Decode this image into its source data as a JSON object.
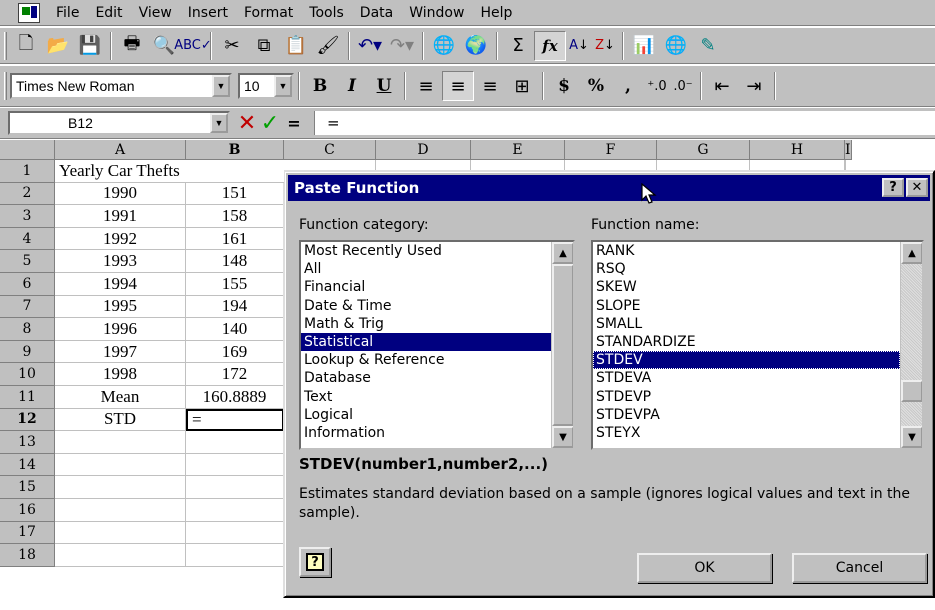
{
  "menubar": {
    "items": [
      {
        "label": "File"
      },
      {
        "label": "Edit"
      },
      {
        "label": "View"
      },
      {
        "label": "Insert"
      },
      {
        "label": "Format"
      },
      {
        "label": "Tools"
      },
      {
        "label": "Data"
      },
      {
        "label": "Window"
      },
      {
        "label": "Help"
      }
    ]
  },
  "formatting": {
    "font_name": "Times New Roman",
    "font_size": "10",
    "bold": "B",
    "italic": "I",
    "underline": "U",
    "currency": "$",
    "percent": "%",
    "comma": ","
  },
  "standard_toolbar": {
    "autosum": "Σ",
    "paste_function": "fx"
  },
  "formula_bar": {
    "name_box": "B12",
    "content": "="
  },
  "sheet": {
    "columns": [
      "A",
      "B",
      "C",
      "D",
      "E",
      "F",
      "G",
      "H",
      "I"
    ],
    "rows": [
      "1",
      "2",
      "3",
      "4",
      "5",
      "6",
      "7",
      "8",
      "9",
      "10",
      "11",
      "12",
      "13",
      "14",
      "15",
      "16",
      "17",
      "18"
    ],
    "title": "Yearly Car Thefts",
    "years": [
      "1990",
      "1991",
      "1992",
      "1993",
      "1994",
      "1995",
      "1996",
      "1997",
      "1998"
    ],
    "values": [
      "151",
      "158",
      "161",
      "148",
      "155",
      "194",
      "140",
      "169",
      "172"
    ],
    "mean_label": "Mean",
    "mean_value": "160.8889",
    "std_label": "STD",
    "std_value": "=",
    "active_cell": "B12"
  },
  "dialog": {
    "title": "Paste Function",
    "help_button": "?",
    "close_button": "✕",
    "category_label": "Function category:",
    "name_label": "Function name:",
    "categories": [
      "Most Recently Used",
      "All",
      "Financial",
      "Date & Time",
      "Math & Trig",
      "Statistical",
      "Lookup & Reference",
      "Database",
      "Text",
      "Logical",
      "Information"
    ],
    "selected_category": "Statistical",
    "functions": [
      "RANK",
      "RSQ",
      "SKEW",
      "SLOPE",
      "SMALL",
      "STANDARDIZE",
      "STDEV",
      "STDEVA",
      "STDEVP",
      "STDEVPA",
      "STEYX"
    ],
    "selected_function": "STDEV",
    "syntax": "STDEV(number1,number2,...)",
    "description": "Estimates standard deviation based on a sample (ignores logical values and text in the sample).",
    "ok": "OK",
    "cancel": "Cancel",
    "office_assistant": "?"
  },
  "colors": {
    "face": "#c0c0c0",
    "title": "#000080",
    "selection": "#000080",
    "cancel_x": "#c00000",
    "enter_check": "#00a000"
  }
}
